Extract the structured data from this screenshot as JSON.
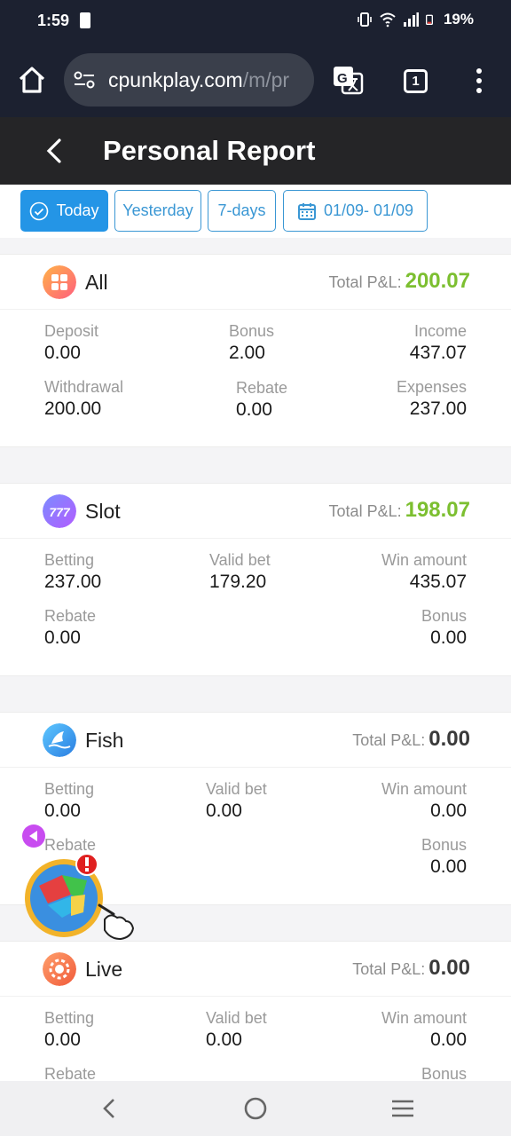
{
  "status_bar": {
    "time": "1:59",
    "battery": "19%"
  },
  "browser": {
    "url_host": "cpunkplay.com",
    "url_path": "/m/pr",
    "tab_count": "1"
  },
  "header": {
    "title": "Personal Report"
  },
  "filters": {
    "today": "Today",
    "yesterday": "Yesterday",
    "seven_days": "7-days",
    "date_range": "01/09- 01/09"
  },
  "total_pnl_label": "Total P&L:",
  "cards": [
    {
      "name": "All",
      "total_pnl": "200.07",
      "stats": {
        "deposit_label": "Deposit",
        "deposit": "0.00",
        "bonus_label": "Bonus",
        "bonus": "2.00",
        "income_label": "Income",
        "income": "437.07",
        "withdrawal_label": "Withdrawal",
        "withdrawal": "200.00",
        "rebate_label": "Rebate",
        "rebate": "0.00",
        "expenses_label": "Expenses",
        "expenses": "237.00"
      }
    },
    {
      "name": "Slot",
      "total_pnl": "198.07",
      "stats": {
        "betting_label": "Betting",
        "betting": "237.00",
        "valid_bet_label": "Valid bet",
        "valid_bet": "179.20",
        "win_amount_label": "Win amount",
        "win_amount": "435.07",
        "rebate_label": "Rebate",
        "rebate": "0.00",
        "bonus_label": "Bonus",
        "bonus": "0.00"
      }
    },
    {
      "name": "Fish",
      "total_pnl": "0.00",
      "stats": {
        "betting_label": "Betting",
        "betting": "0.00",
        "valid_bet_label": "Valid bet",
        "valid_bet": "0.00",
        "win_amount_label": "Win amount",
        "win_amount": "0.00",
        "rebate_label": "Rebate",
        "bonus_label": "Bonus",
        "bonus": "0.00"
      }
    },
    {
      "name": "Live",
      "total_pnl": "0.00",
      "stats": {
        "betting_label": "Betting",
        "betting": "0.00",
        "valid_bet_label": "Valid bet",
        "valid_bet": "0.00",
        "win_amount_label": "Win amount",
        "win_amount": "0.00",
        "rebate_label": "Rebate",
        "bonus_label": "Bonus"
      }
    }
  ],
  "colors": {
    "accent": "#2495e6",
    "profit": "#7cbf30",
    "header_bg": "#252527"
  }
}
